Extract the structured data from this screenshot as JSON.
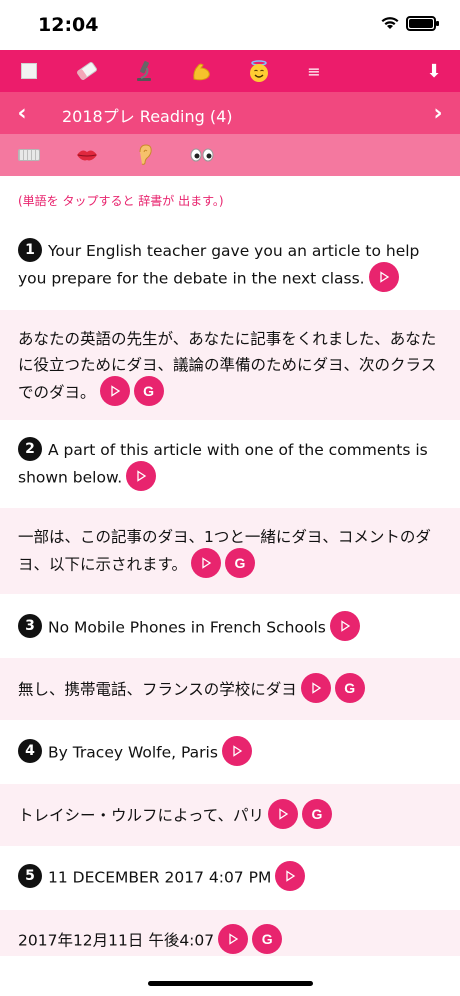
{
  "status": {
    "time": "12:04"
  },
  "toolbar": {
    "icons": [
      "stop-icon",
      "eraser-icon",
      "microscope-icon",
      "muscle-icon",
      "halo-face-icon",
      "menu-icon",
      "download-icon"
    ],
    "menu_glyph": "≡",
    "download_glyph": "⬇"
  },
  "nav": {
    "title": "2018プレ Reading (4)",
    "prev": "‹",
    "next": "›"
  },
  "modes": [
    "keyboard-icon",
    "lips-icon",
    "ear-icon",
    "eyes-icon"
  ],
  "hint": "(単語を タップすると 辞書が 出ます。)",
  "entries": [
    {
      "num": "1",
      "en": "Your English teacher gave you an article to help you prepare for the debate in the next class.",
      "jp": "あなたの英語の先生が、あなたに記事をくれました、あなたに役立つためにダヨ、議論の準備のためにダヨ、次のクラスでのダヨ。"
    },
    {
      "num": "2",
      "en": "A part of this article with one of the comments is shown below.",
      "jp": "一部は、この記事のダヨ、1つと一緒にダヨ、コメントのダヨ、以下に示されます。"
    },
    {
      "num": "3",
      "en": "No Mobile Phones in French Schools",
      "jp": "無し、携帯電話、フランスの学校にダヨ"
    },
    {
      "num": "4",
      "en": "By Tracey Wolfe, Paris",
      "jp": "トレイシー・ウルフによって、パリ"
    },
    {
      "num": "5",
      "en": "11 DECEMBER 2017 4:07 PM",
      "jp": "2017年12月11日 午後4:07"
    }
  ],
  "google_label": "G",
  "colors": {
    "accent": "#ec1c6b",
    "nav": "#f1487f",
    "mode": "#f4789f",
    "jp_bg": "#fdeff4"
  }
}
